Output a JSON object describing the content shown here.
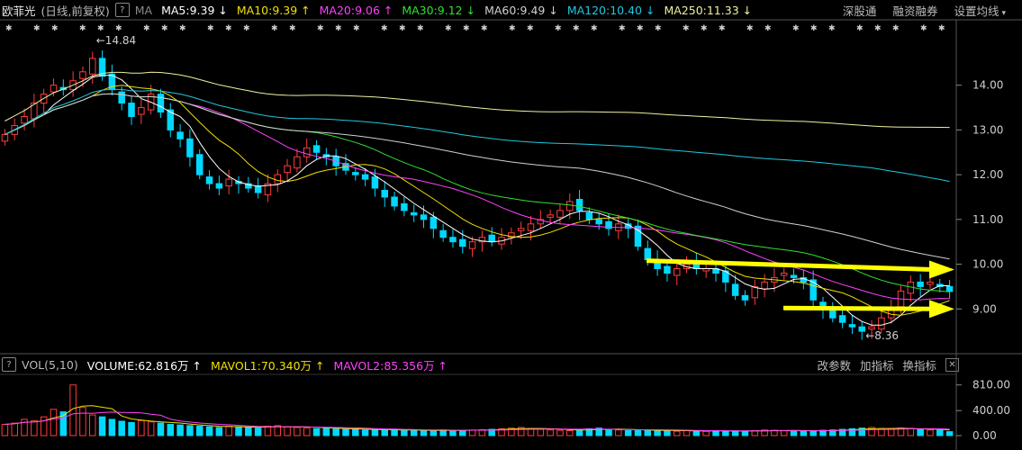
{
  "header": {
    "stock_name": "欧菲光",
    "period": "(日线,前复权)",
    "help_icon": "question-icon",
    "ma_label": "MA",
    "ma_items": [
      {
        "label": "MA5:9.39",
        "arrow": "↓",
        "color": "#ffffff"
      },
      {
        "label": "MA10:9.39",
        "arrow": "↑",
        "color": "#f0e000"
      },
      {
        "label": "MA20:9.06",
        "arrow": "↑",
        "color": "#ff40ff"
      },
      {
        "label": "MA30:9.12",
        "arrow": "↓",
        "color": "#30e030"
      },
      {
        "label": "MA60:9.49",
        "arrow": "↓",
        "color": "#d0d0d0"
      },
      {
        "label": "MA120:10.40",
        "arrow": "↓",
        "color": "#20c8e0"
      },
      {
        "label": "MA250:11.33",
        "arrow": "↓",
        "color": "#f0f0a0"
      }
    ],
    "tools": [
      "深股通",
      "融资融券",
      "设置均线"
    ]
  },
  "volume_header": {
    "label": "VOL(5,10)",
    "items": [
      {
        "label": "VOLUME:62.816万",
        "arrow": "↑",
        "color": "#ffffff"
      },
      {
        "label": "MAVOL1:70.340万",
        "arrow": "↑",
        "color": "#f0e000"
      },
      {
        "label": "MAVOL2:85.356万",
        "arrow": "↑",
        "color": "#ff40ff"
      }
    ],
    "tools": [
      "改参数",
      "加指标",
      "换指标"
    ],
    "close_icon": "close-icon"
  },
  "chart_data": {
    "type": "candlestick",
    "price_axis": {
      "ticks": [
        "14.00",
        "13.00",
        "12.00",
        "11.00",
        "10.00",
        "9.00"
      ],
      "ylim": [
        8.1,
        15.1
      ]
    },
    "volume_axis": {
      "ticks": [
        "810.00",
        "400.00",
        "0.00"
      ],
      "ylim": [
        0,
        950
      ]
    },
    "annotations": [
      {
        "text": "←14.84",
        "value": 14.84,
        "kind": "high"
      },
      {
        "text": "←8.36",
        "value": 8.36,
        "kind": "low"
      }
    ],
    "colors": {
      "up": "#ff3c3c",
      "down": "#00d8ff",
      "highlight_arrow": "#ffff00"
    },
    "trend_arrows": [
      {
        "from": 10.08,
        "to": 9.88
      },
      {
        "from": 9.02,
        "to": 9.0
      }
    ],
    "closes": [
      12.9,
      13.1,
      13.3,
      13.6,
      13.8,
      14.0,
      13.9,
      14.1,
      14.3,
      14.6,
      14.2,
      13.9,
      13.6,
      13.3,
      13.5,
      13.8,
      13.4,
      13.0,
      12.8,
      12.4,
      12.0,
      11.8,
      11.7,
      11.9,
      11.8,
      11.7,
      11.6,
      11.8,
      12.0,
      12.2,
      12.4,
      12.6,
      12.5,
      12.4,
      12.2,
      12.1,
      12.0,
      11.9,
      11.7,
      11.5,
      11.3,
      11.2,
      11.1,
      11.0,
      10.8,
      10.6,
      10.5,
      10.4,
      10.5,
      10.6,
      10.5,
      10.6,
      10.7,
      10.8,
      10.9,
      11.0,
      11.1,
      11.2,
      11.4,
      11.2,
      11.0,
      10.9,
      10.8,
      10.9,
      10.8,
      10.4,
      10.1,
      9.9,
      9.8,
      9.9,
      10.0,
      9.9,
      9.9,
      9.8,
      9.6,
      9.3,
      9.2,
      9.5,
      9.6,
      9.7,
      9.8,
      9.7,
      9.6,
      9.2,
      9.0,
      8.8,
      8.7,
      8.6,
      8.5,
      8.6,
      8.8,
      9.0,
      9.4,
      9.6,
      9.5,
      9.6,
      9.5,
      9.39
    ],
    "volumes": [
      180,
      200,
      260,
      240,
      300,
      420,
      380,
      810,
      450,
      330,
      300,
      260,
      230,
      210,
      240,
      220,
      200,
      180,
      170,
      160,
      150,
      140,
      130,
      150,
      140,
      130,
      120,
      150,
      160,
      140,
      130,
      120,
      110,
      120,
      110,
      100,
      100,
      90,
      90,
      100,
      90,
      85,
      80,
      80,
      85,
      90,
      80,
      85,
      90,
      95,
      100,
      110,
      120,
      130,
      110,
      100,
      90,
      85,
      80,
      95,
      110,
      120,
      100,
      90,
      80,
      85,
      90,
      80,
      75,
      70,
      80,
      75,
      70,
      80,
      70,
      75,
      70,
      80,
      90,
      85,
      80,
      75,
      70,
      80,
      85,
      90,
      100,
      110,
      120,
      130,
      110,
      100,
      120,
      110,
      100,
      90,
      85,
      62.8
    ],
    "ma_series": [
      "MA5",
      "MA10",
      "MA20",
      "MA30",
      "MA60",
      "MA120",
      "MA250"
    ]
  }
}
